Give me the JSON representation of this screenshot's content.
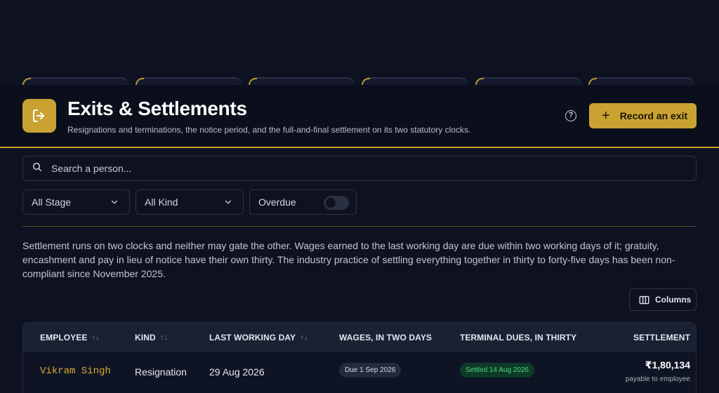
{
  "header": {
    "title": "Exits & Settlements",
    "subtitle": "Resignations and terminations, the notice period, and the full-and-final settlement on its two statutory clocks.",
    "record_button_label": "Record an exit",
    "help_label": "?"
  },
  "search": {
    "placeholder": "Search a person..."
  },
  "filters": {
    "stage_label": "All Stage",
    "kind_label": "All Kind",
    "overdue_label": "Overdue",
    "overdue_on": false
  },
  "note": "Settlement runs on two clocks and neither may gate the other. Wages earned to the last working day are due within two working days of it; gratuity, encashment and pay in lieu of notice have their own thirty. The industry practice of settling everything together in thirty to forty-five days has been non-compliant since November 2025.",
  "columns_button_label": "Columns",
  "table": {
    "headers": {
      "employee": "EMPLOYEE",
      "kind": "KIND",
      "last_working_day": "LAST WORKING DAY",
      "wages": "WAGES, IN TWO DAYS",
      "terminal_dues": "TERMINAL DUES, IN THIRTY",
      "settlement": "SETTLEMENT"
    },
    "rows": [
      {
        "employee": "Vikram Singh",
        "kind": "Resignation",
        "last_working_day": "29 Aug 2026",
        "wages": "Due 1 Sep 2026",
        "terminal_dues": "Settled 14 Aug 2026",
        "settlement_amount": "₹1,80,134",
        "settlement_note": "payable to employee"
      }
    ]
  },
  "colors": {
    "accent": "#c9a232",
    "background": "#0d1120",
    "settled_green": "#4cd68a"
  },
  "icons": {
    "page": "exit-door-icon",
    "search": "search-icon",
    "chevron": "chevron-down-icon",
    "sort": "sort-icon",
    "columns": "columns-icon",
    "help": "help-circle-icon",
    "plus": "plus-icon"
  }
}
